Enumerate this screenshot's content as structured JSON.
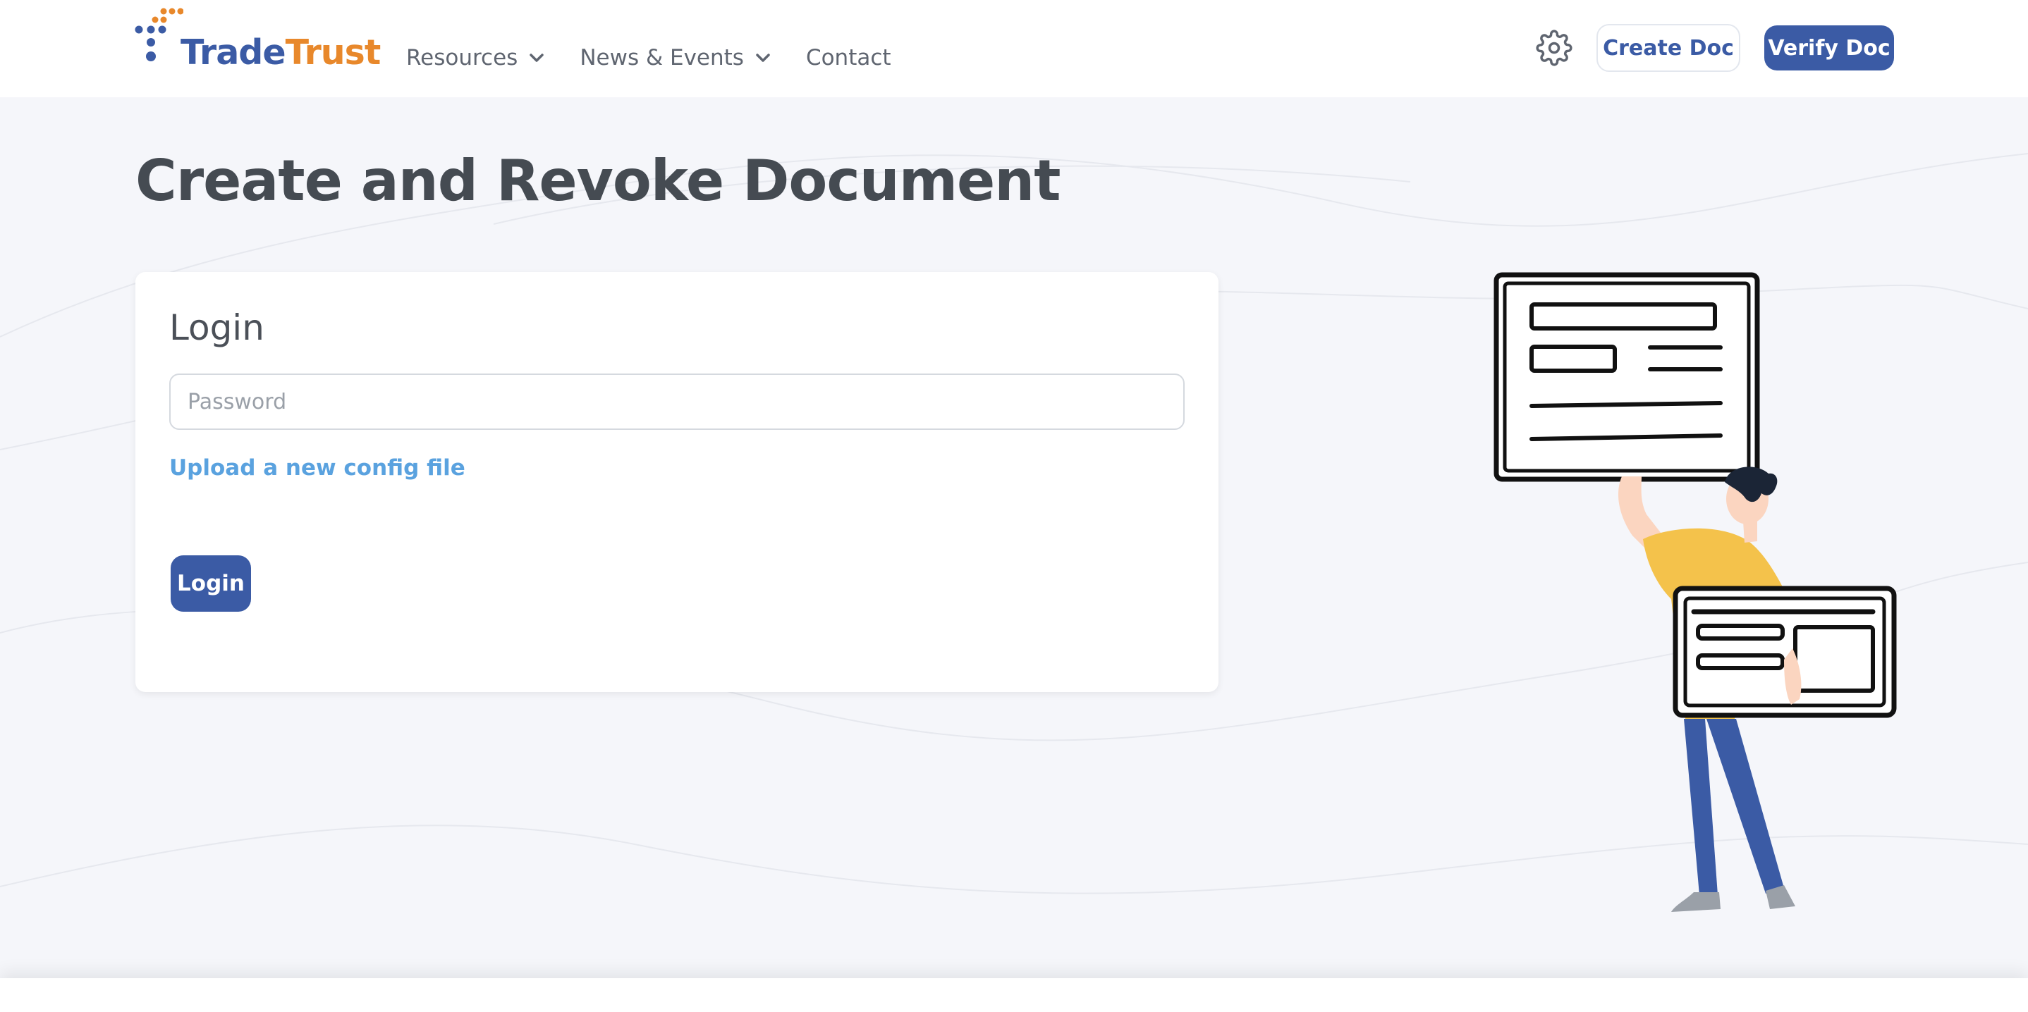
{
  "brand": {
    "name_part1": "Trade",
    "name_part2": "Trust",
    "color_primary": "#3b5ba5",
    "color_accent": "#e8882b"
  },
  "nav": {
    "items": [
      {
        "label": "Resources",
        "has_dropdown": true
      },
      {
        "label": "News & Events",
        "has_dropdown": true
      },
      {
        "label": "Contact",
        "has_dropdown": false
      }
    ]
  },
  "header_actions": {
    "settings_icon": "gear-icon",
    "create_label": "Create Doc",
    "verify_label": "Verify Doc"
  },
  "page": {
    "title": "Create and Revoke Document"
  },
  "login": {
    "title": "Login",
    "password_value": "",
    "password_placeholder": "Password",
    "config_link": "Upload a new config file",
    "submit_label": "Login"
  },
  "illustration": {
    "icon": "person-holding-documents-illustration"
  }
}
